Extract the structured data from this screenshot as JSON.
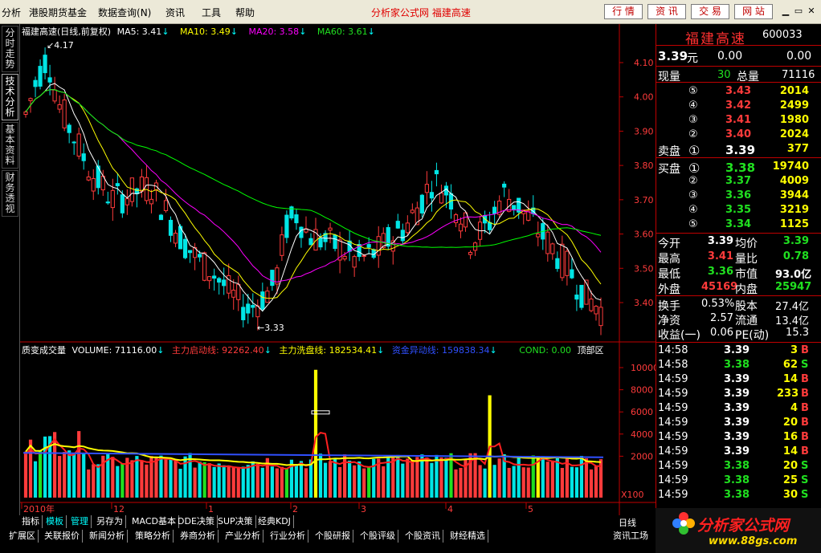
{
  "menu": [
    "分析",
    "港股期货基金",
    "数据查询",
    "资讯",
    "工具",
    "帮助"
  ],
  "menu_hotkeys": [
    "",
    "",
    "(N)",
    "",
    "",
    ""
  ],
  "app_title": "分析家公式网  福建高速",
  "nav_buttons": [
    "行 情",
    "资 讯",
    "交 易",
    "网 站"
  ],
  "side_tabs": [
    "分时走势",
    "技术分析",
    "基本资料",
    "财务透视"
  ],
  "main_legend": {
    "name": "福建高速(日线,前复权)",
    "ma5": "MA5: 3.41",
    "ma10": "MA10: 3.49",
    "ma20": "MA20: 3.58",
    "ma60": "MA60: 3.61",
    "high_label": "4.17",
    "low_label": "3.33"
  },
  "vol_legend": {
    "name": "质变成交量",
    "volume": "VOLUME: 71116.00",
    "zlqd": "主力启动线: 92262.40",
    "zlxp": "主力洗盘线: 182534.41",
    "zjyd": "资金异动线: 159838.34",
    "cond": "COND: 0.00",
    "top": "顶部区"
  },
  "price_axis": [
    "4.10",
    "4.00",
    "3.90",
    "3.80",
    "3.70",
    "3.60",
    "3.50",
    "3.40"
  ],
  "vol_axis": [
    "10000",
    "8000",
    "6000",
    "4000",
    "2000"
  ],
  "vol_unit": "X100",
  "x_axis": [
    "2010年",
    "12",
    "1",
    "2",
    "3",
    "4",
    "5"
  ],
  "period": "日线",
  "colors": {
    "up": "#ff3b3b",
    "down": "#00e5e5",
    "ma5": "#ffffff",
    "ma10": "#ffff00",
    "ma20": "#ff00ff",
    "ma60": "#00ff00"
  },
  "stock": {
    "name": "福建高速",
    "code": "600033",
    "price": "3.39",
    "unit": "元",
    "change": "0.00",
    "pct": "0.00"
  },
  "quote": {
    "xianliang_label": "现量",
    "xianliang": "30",
    "zongliang_label": "总量",
    "zongliang": "71116",
    "sell": [
      {
        "lvl": "⑤",
        "price": "3.43",
        "vol": "2014"
      },
      {
        "lvl": "④",
        "price": "3.42",
        "vol": "2499"
      },
      {
        "lvl": "③",
        "price": "3.41",
        "vol": "1980"
      },
      {
        "lvl": "②",
        "price": "3.40",
        "vol": "2024"
      },
      {
        "lvl": "①",
        "price": "3.39",
        "vol": "377"
      }
    ],
    "sell_label": "卖盘",
    "buy_label": "买盘",
    "buy": [
      {
        "lvl": "①",
        "price": "3.38",
        "vol": "19740"
      },
      {
        "lvl": "②",
        "price": "3.37",
        "vol": "4009"
      },
      {
        "lvl": "③",
        "price": "3.36",
        "vol": "3944"
      },
      {
        "lvl": "④",
        "price": "3.35",
        "vol": "3219"
      },
      {
        "lvl": "⑤",
        "price": "3.34",
        "vol": "1125"
      }
    ],
    "stats": [
      {
        "l1": "今开",
        "v1": "3.39",
        "c1": "w",
        "l2": "均价",
        "v2": "3.39",
        "c2": "g"
      },
      {
        "l1": "最高",
        "v1": "3.41",
        "c1": "r",
        "l2": "量比",
        "v2": "0.78",
        "c2": "g"
      },
      {
        "l1": "最低",
        "v1": "3.36",
        "c1": "g",
        "l2": "市值",
        "v2": "93.0亿",
        "c2": "w"
      },
      {
        "l1": "外盘",
        "v1": "45169",
        "c1": "r",
        "l2": "内盘",
        "v2": "25947",
        "c2": "g"
      }
    ],
    "stats2": [
      {
        "l1": "换手",
        "v1": "0.53%",
        "l2": "股本",
        "v2": "27.4亿"
      },
      {
        "l1": "净资",
        "v1": "2.57",
        "l2": "流通",
        "v2": "13.4亿"
      },
      {
        "l1": "收益(一)",
        "v1": "0.06",
        "l2": "PE(动)",
        "v2": "15.3"
      }
    ],
    "ticks": [
      {
        "t": "14:58",
        "p": "3.39",
        "pc": "w",
        "v": "3",
        "s": "B"
      },
      {
        "t": "14:58",
        "p": "3.38",
        "pc": "g",
        "v": "62",
        "s": "S"
      },
      {
        "t": "14:59",
        "p": "3.39",
        "pc": "w",
        "v": "14",
        "s": "B"
      },
      {
        "t": "14:59",
        "p": "3.39",
        "pc": "w",
        "v": "233",
        "s": "B"
      },
      {
        "t": "14:59",
        "p": "3.39",
        "pc": "w",
        "v": "4",
        "s": "B"
      },
      {
        "t": "14:59",
        "p": "3.39",
        "pc": "w",
        "v": "20",
        "s": "B"
      },
      {
        "t": "14:59",
        "p": "3.39",
        "pc": "w",
        "v": "16",
        "s": "B"
      },
      {
        "t": "14:59",
        "p": "3.39",
        "pc": "w",
        "v": "14",
        "s": "B"
      },
      {
        "t": "14:59",
        "p": "3.38",
        "pc": "g",
        "v": "20",
        "s": "S"
      },
      {
        "t": "14:59",
        "p": "3.38",
        "pc": "g",
        "v": "25",
        "s": "S"
      },
      {
        "t": "14:59",
        "p": "3.38",
        "pc": "g",
        "v": "30",
        "s": "S"
      }
    ]
  },
  "tabs_row1": [
    "指标",
    "模板",
    "管理",
    "另存为",
    "MACD基本",
    "DDE决策",
    "SUP决策",
    "经典KDJ"
  ],
  "tabs_row2": [
    "扩展区",
    "关联报价",
    "新闻分析",
    "策略分析",
    "券商分析",
    "产业分析",
    "行业分析",
    "个股研报",
    "个股评级",
    "个股资讯",
    "财经精选"
  ],
  "bottom_right": "资讯工场",
  "logo": {
    "main": "分析家公式网",
    "url": "www.88gs.com"
  }
}
